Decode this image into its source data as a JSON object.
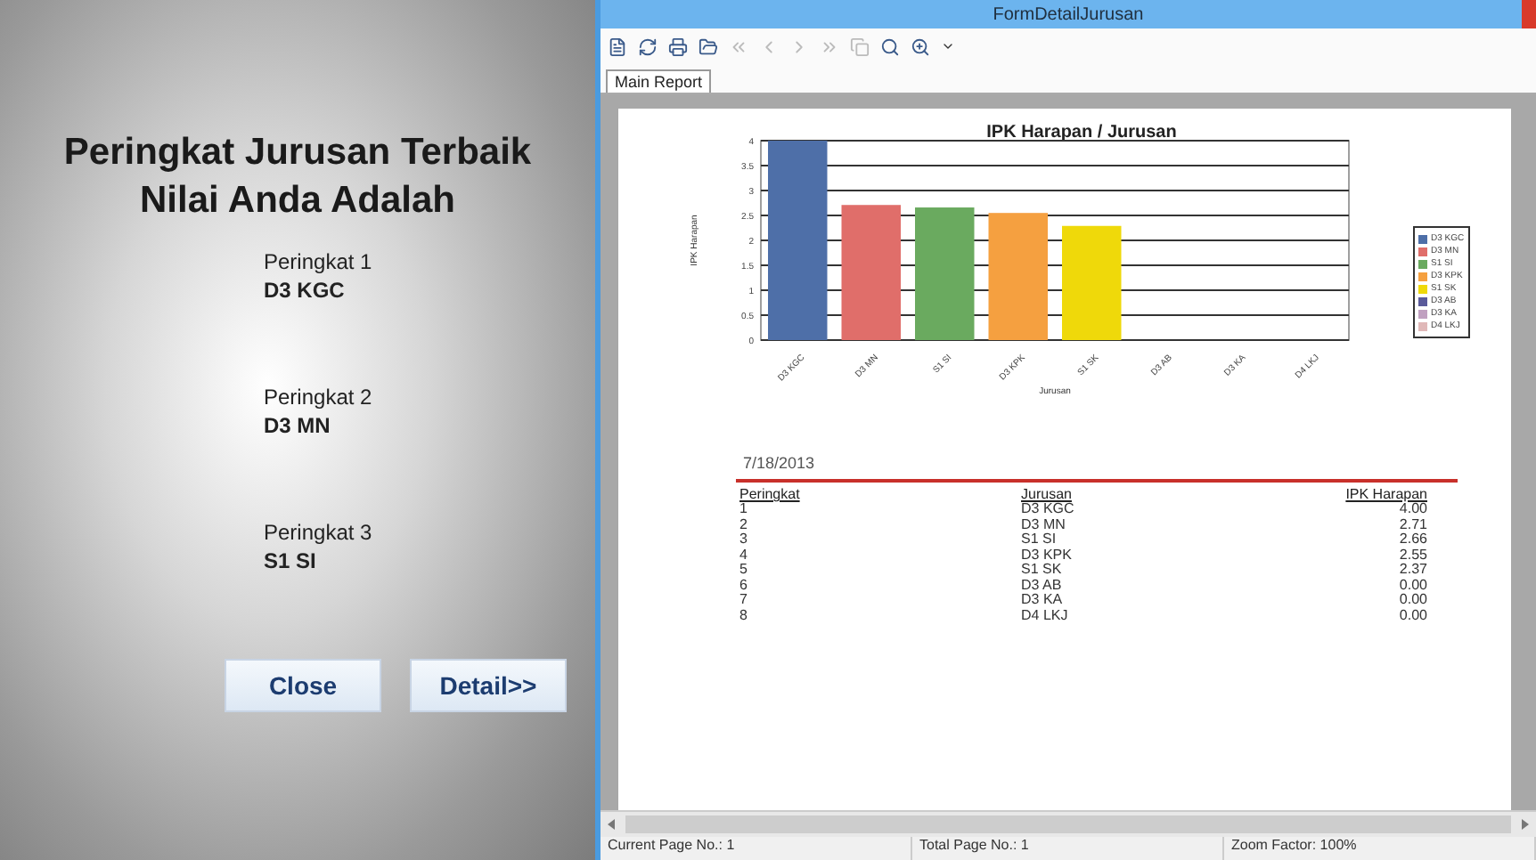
{
  "left_panel": {
    "heading": [
      "Peringkat Jurusan Terbaik",
      "Nilai Anda Adalah"
    ],
    "rankings": [
      {
        "label": "Peringkat 1",
        "value": "D3 KGC"
      },
      {
        "label": "Peringkat 2",
        "value": "D3 MN"
      },
      {
        "label": "Peringkat 3",
        "value": "S1 SI"
      }
    ],
    "buttons": [
      "Close",
      "Detail>>"
    ]
  },
  "window": {
    "title": "FormDetailJurusan"
  },
  "tabs": [
    {
      "label": "Main Report",
      "selected": true
    }
  ],
  "report": {
    "chart_data": {
      "type": "bar",
      "title": "IPK Harapan / Jurusan",
      "xlabel": "Jurusan",
      "ylabel": "IPK Harapan",
      "categories": [
        "D3 KGC",
        "D3 MN",
        "S1 SI",
        "D3 KPK",
        "S1 SK",
        "D3 AB",
        "D3 KA",
        "D4 LKJ"
      ],
      "series": [
        {
          "name": "D3 KGC",
          "color": "#4e6fa8",
          "values": [
            4.0,
            null,
            null,
            null,
            null,
            null,
            null,
            null
          ]
        },
        {
          "name": "D3 MN",
          "color": "#e06e6a",
          "values": [
            null,
            2.71,
            null,
            null,
            null,
            null,
            null,
            null
          ]
        },
        {
          "name": "S1 SI",
          "color": "#6aaa5f",
          "values": [
            null,
            null,
            2.66,
            null,
            null,
            null,
            null,
            null
          ]
        },
        {
          "name": "D3 KPK",
          "color": "#f5a040",
          "values": [
            null,
            null,
            null,
            2.55,
            null,
            null,
            null,
            null
          ]
        },
        {
          "name": "S1 SK",
          "color": "#efd90a",
          "values": [
            null,
            null,
            null,
            null,
            2.29,
            null,
            null,
            null
          ]
        },
        {
          "name": "D3 AB",
          "color": "#5a5a9a",
          "values": [
            null,
            null,
            null,
            null,
            null,
            0,
            null,
            null
          ]
        },
        {
          "name": "D3 KA",
          "color": "#c0a0c0",
          "values": [
            null,
            null,
            null,
            null,
            null,
            null,
            0,
            null
          ]
        },
        {
          "name": "D4 LKJ",
          "color": "#e0b8b8",
          "values": [
            null,
            null,
            null,
            null,
            null,
            null,
            null,
            0
          ]
        }
      ],
      "grid": true,
      "ylim": [
        0,
        4
      ],
      "yticks": [
        0,
        0.5,
        1,
        1.5,
        2,
        2.5,
        3,
        3.5,
        4
      ]
    },
    "date": "7/18/2013",
    "table": {
      "columns": [
        "Peringkat",
        "Jurusan",
        "IPK Harapan"
      ],
      "rows": [
        [
          "1",
          "D3 KGC",
          "4.00"
        ],
        [
          "2",
          "D3 MN",
          "2.71"
        ],
        [
          "3",
          "S1 SI",
          "2.66"
        ],
        [
          "4",
          "D3 KPK",
          "2.55"
        ],
        [
          "5",
          "S1 SK",
          "2.37"
        ],
        [
          "6",
          "D3 AB",
          "0.00"
        ],
        [
          "7",
          "D3 KA",
          "0.00"
        ],
        [
          "8",
          "D4 LKJ",
          "0.00"
        ]
      ]
    }
  },
  "status_bar": [
    "Current Page No.: 1",
    "Total Page No.: 1",
    "Zoom Factor: 100%"
  ]
}
